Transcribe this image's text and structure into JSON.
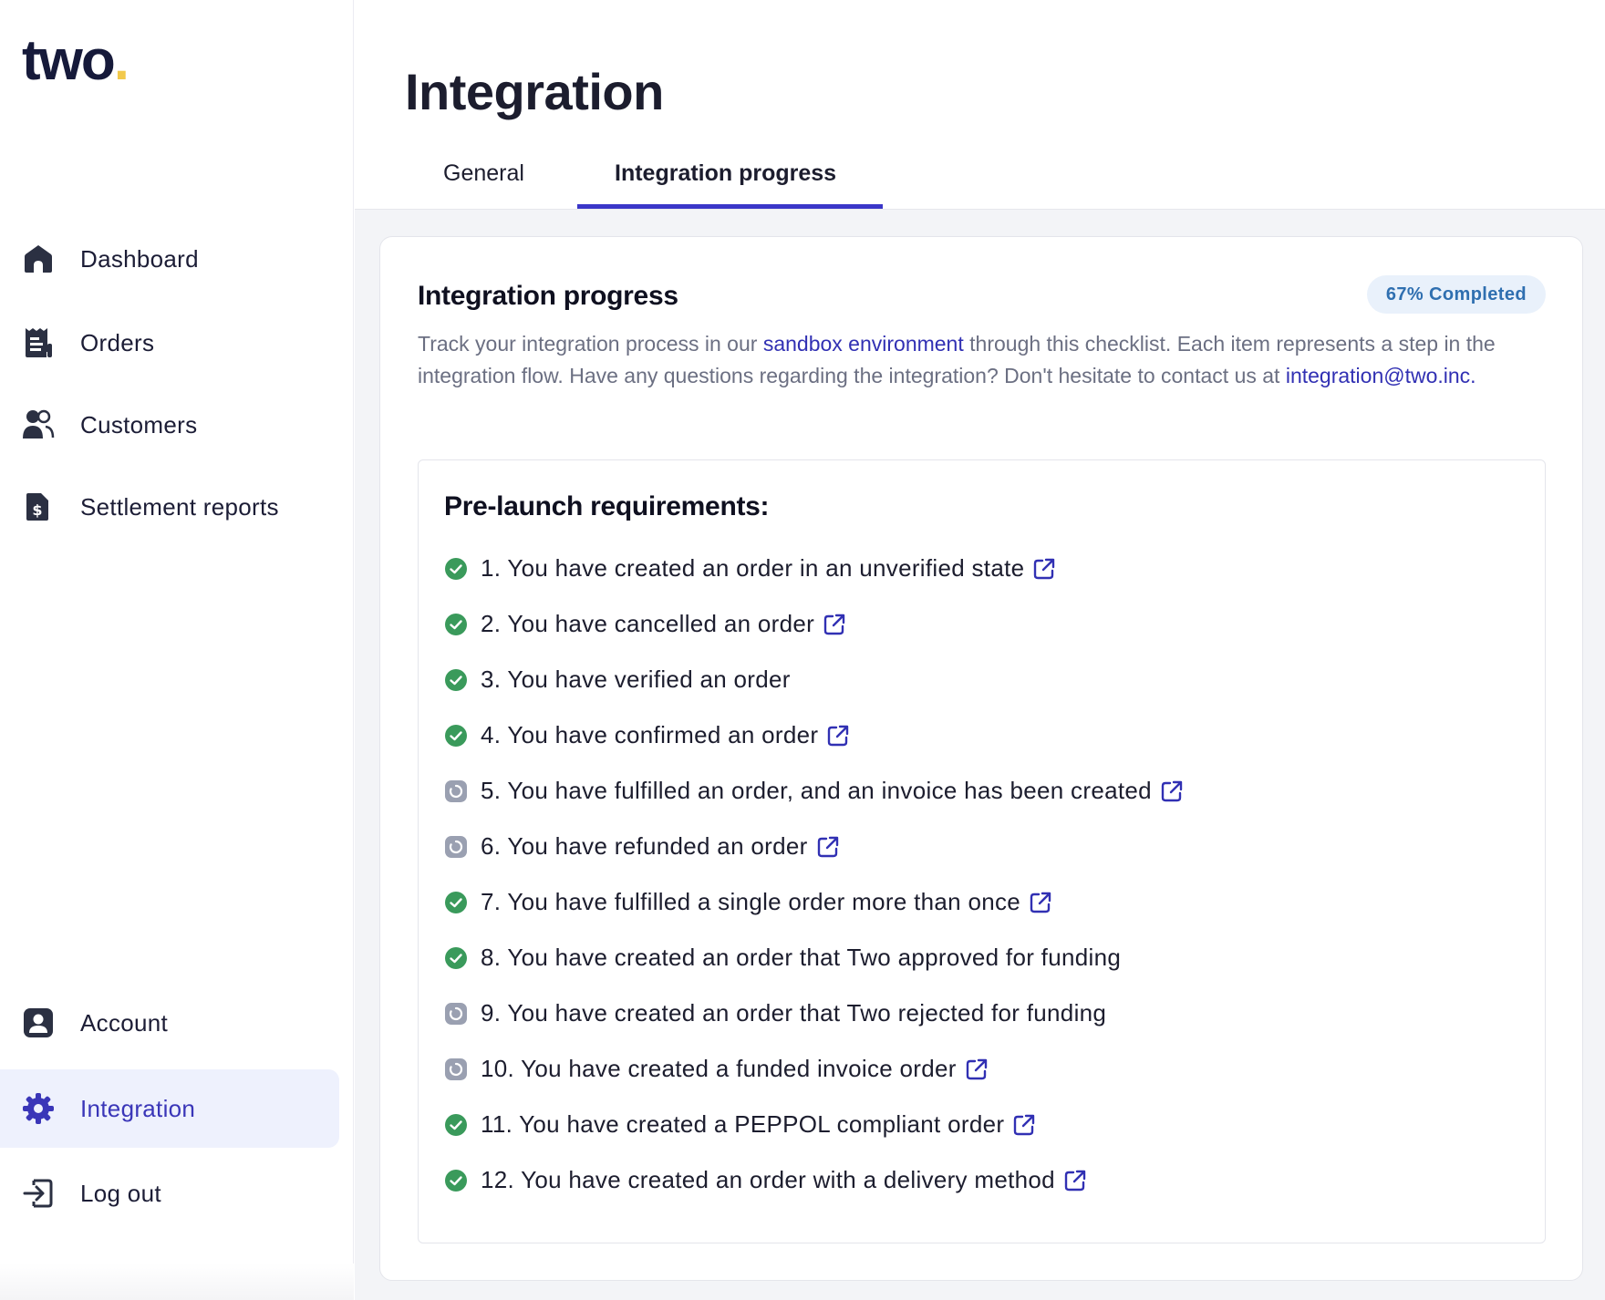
{
  "brand": {
    "logo_text": "two",
    "logo_dot": ".",
    "accent": "#3a36c8",
    "logo_dot_color": "#f2c94c"
  },
  "sidebar": {
    "items": [
      {
        "label": "Dashboard",
        "icon": "home-icon"
      },
      {
        "label": "Orders",
        "icon": "orders-icon"
      },
      {
        "label": "Customers",
        "icon": "customers-icon"
      },
      {
        "label": "Settlement reports",
        "icon": "settlement-report-icon"
      }
    ],
    "bottom_items": [
      {
        "label": "Account",
        "icon": "account-icon"
      },
      {
        "label": "Integration",
        "icon": "gear-icon",
        "active": true
      },
      {
        "label": "Log out",
        "icon": "logout-icon"
      }
    ]
  },
  "header": {
    "title": "Integration",
    "tabs": [
      {
        "label": "General",
        "active": false
      },
      {
        "label": "Integration progress",
        "active": true
      }
    ]
  },
  "card": {
    "title": "Integration progress",
    "badge": "67% Completed",
    "description": {
      "before_link": "Track your integration process in our ",
      "link_text": "sandbox environment",
      "after_link": " through this checklist. Each item represents a step in the integration flow. Have any questions regarding the integration? Don't hesitate to contact us at ",
      "email": "integration@two.inc."
    }
  },
  "requirements": {
    "title": "Pre-launch requirements:",
    "items": [
      {
        "text": "1. You have created an order in an unverified state",
        "status": "done",
        "has_link": true
      },
      {
        "text": "2. You have cancelled an order",
        "status": "done",
        "has_link": true
      },
      {
        "text": "3. You have verified an order",
        "status": "done",
        "has_link": false
      },
      {
        "text": "4. You have confirmed an order",
        "status": "done",
        "has_link": true
      },
      {
        "text": "5. You have fulfilled an order, and an invoice has been created",
        "status": "pending",
        "has_link": true
      },
      {
        "text": "6. You have refunded an order",
        "status": "pending",
        "has_link": true
      },
      {
        "text": "7. You have fulfilled a single order more than once",
        "status": "done",
        "has_link": true
      },
      {
        "text": "8. You have created an order that Two approved for funding",
        "status": "done",
        "has_link": false
      },
      {
        "text": "9. You have created an order that Two rejected for funding",
        "status": "pending",
        "has_link": false
      },
      {
        "text": "10. You have created a funded invoice order",
        "status": "pending",
        "has_link": true
      },
      {
        "text": "11. You have created a PEPPOL compliant order",
        "status": "done",
        "has_link": true
      },
      {
        "text": "12. You have created an order with a delivery method",
        "status": "done",
        "has_link": true
      }
    ]
  },
  "colors": {
    "done": "#3a9a5b",
    "pending": "#9aa0b1",
    "link": "#3130b3"
  }
}
